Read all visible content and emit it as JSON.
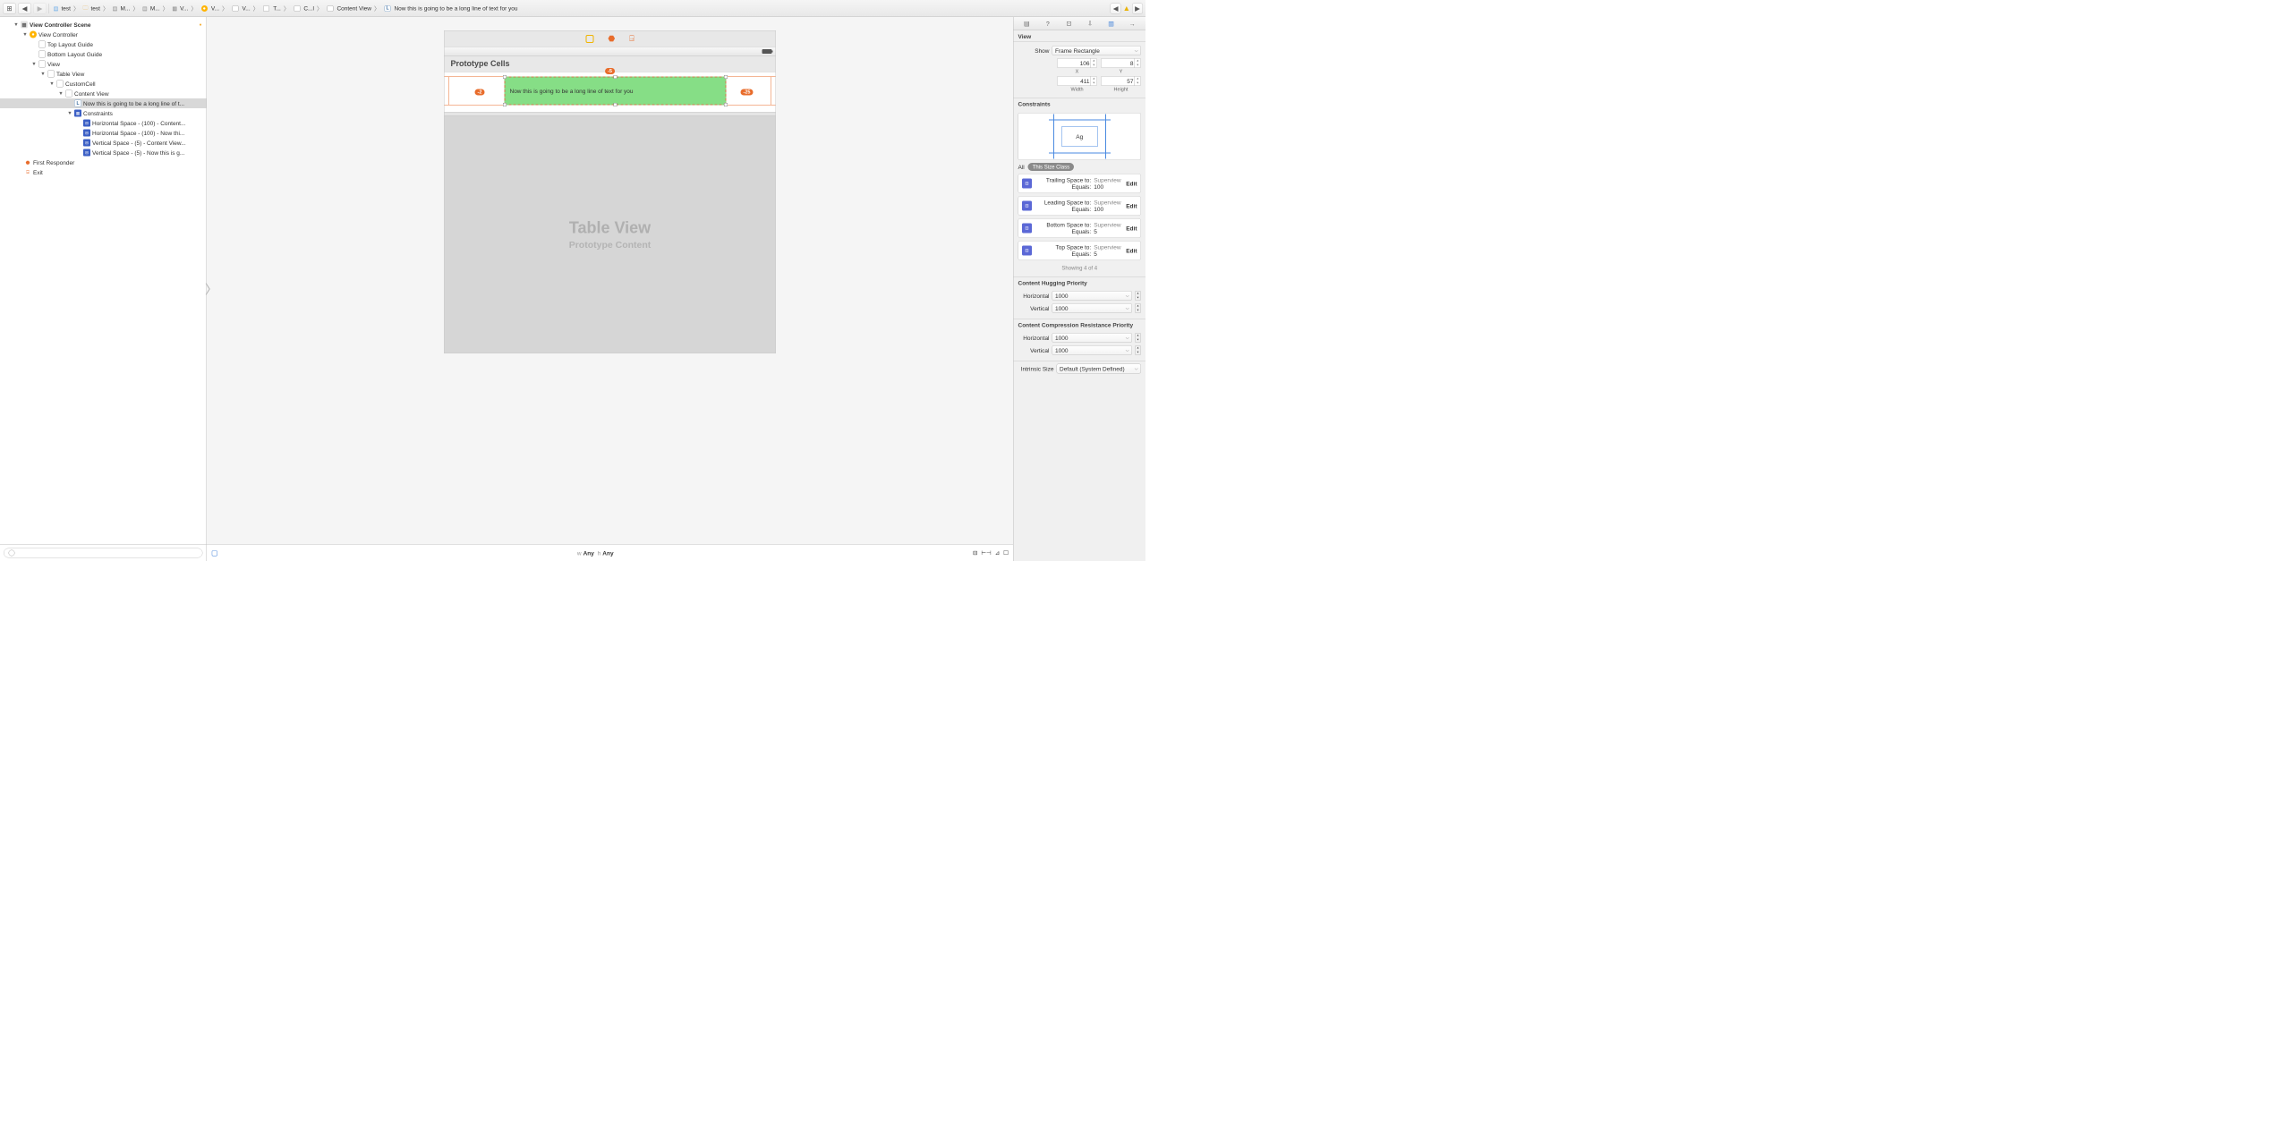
{
  "breadcrumb": [
    {
      "icon": "swift",
      "label": "test"
    },
    {
      "icon": "folder",
      "label": "test"
    },
    {
      "icon": "storyboard",
      "label": "M..."
    },
    {
      "icon": "storyboard",
      "label": "M..."
    },
    {
      "icon": "scene",
      "label": "V..."
    },
    {
      "icon": "vc",
      "label": "V..."
    },
    {
      "icon": "view",
      "label": "V..."
    },
    {
      "icon": "view",
      "label": "T..."
    },
    {
      "icon": "view",
      "label": "C...l"
    },
    {
      "icon": "view",
      "label": "Content View"
    },
    {
      "icon": "label",
      "label": "Now this is going to be a long line of text for you"
    }
  ],
  "outline": {
    "sceneTitle": "View Controller Scene",
    "vc": "View Controller",
    "topGuide": "Top Layout Guide",
    "bottomGuide": "Bottom Layout Guide",
    "view": "View",
    "tableView": "Table View",
    "customCell": "CustomCell",
    "contentView": "Content View",
    "labelRow": "Now this is going to be a long line of t...",
    "constraintsNode": "Constraints",
    "c1": "Horizontal Space - (100) - Content...",
    "c2": "Horizontal Space - (100) - Now thi...",
    "c3": "Vertical Space - (5) - Content View...",
    "c4": "Vertical Space - (5) - Now this is g...",
    "firstResponder": "First Responder",
    "exit": "Exit"
  },
  "canvas": {
    "protoHeader": "Prototype Cells",
    "labelText": "Now this is going to be a long line of text for you",
    "badges": {
      "top": "-5",
      "left": "-2",
      "right": "-25"
    },
    "tableViewTitle": "Table View",
    "prototypeContent": "Prototype Content"
  },
  "sizeClass": {
    "wLabel": "w",
    "wVal": "Any",
    "hLabel": "h",
    "hVal": "Any"
  },
  "inspector": {
    "viewSection": "View",
    "showLabel": "Show",
    "showValue": "Frame Rectangle",
    "x": "106",
    "y": "8",
    "xLabel": "X",
    "yLabel": "Y",
    "w": "411",
    "h": "57",
    "wLabel": "Width",
    "hLabel": "Height",
    "constraintsSection": "Constraints",
    "ag": "Ag",
    "all": "All",
    "thisSizeClass": "This Size Class",
    "cards": [
      {
        "l1k": "Trailing Space to:",
        "l1v": "Superview",
        "l2k": "Equals:",
        "l2v": "100",
        "edit": "Edit"
      },
      {
        "l1k": "Leading Space to:",
        "l1v": "Superview",
        "l2k": "Equals:",
        "l2v": "100",
        "edit": "Edit"
      },
      {
        "l1k": "Bottom Space to:",
        "l1v": "Superview",
        "l2k": "Equals:",
        "l2v": "5",
        "edit": "Edit"
      },
      {
        "l1k": "Top Space to:",
        "l1v": "Superview",
        "l2k": "Equals:",
        "l2v": "5",
        "edit": "Edit"
      }
    ],
    "showing": "Showing 4 of 4",
    "hugging": "Content Hugging Priority",
    "hugH": "Horizontal",
    "hugHVal": "1000",
    "hugV": "Vertical",
    "hugVVal": "1000",
    "compression": "Content Compression Resistance Priority",
    "compH": "Horizontal",
    "compHVal": "1000",
    "compV": "Vertical",
    "compVVal": "1000",
    "intrinsicLabel": "Intrinsic Size",
    "intrinsicValue": "Default (System Defined)"
  }
}
